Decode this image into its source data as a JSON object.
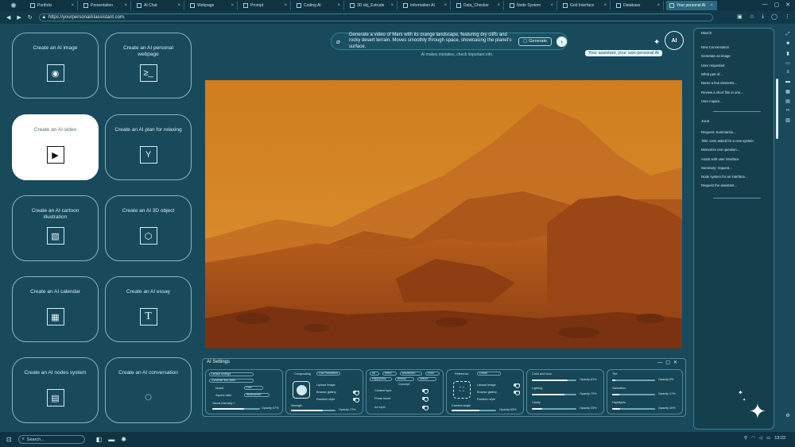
{
  "tabs": [
    {
      "label": "Portfolio"
    },
    {
      "label": "Presentation"
    },
    {
      "label": "AI Chat"
    },
    {
      "label": "Webpage"
    },
    {
      "label": "Prompt"
    },
    {
      "label": "Coding AI"
    },
    {
      "label": "3D obj_Extrude"
    },
    {
      "label": "Information AI"
    },
    {
      "label": "Data_Checker"
    },
    {
      "label": "Node System"
    },
    {
      "label": "Grid Interface"
    },
    {
      "label": "Database"
    },
    {
      "label": "Your personal AI"
    }
  ],
  "address": {
    "url": "https://yourpersonalAIassistant.com."
  },
  "cards": [
    {
      "label": "Create an AI image",
      "icon": "image-search-icon",
      "glyph": "◉"
    },
    {
      "label": "Create an AI personal webpage",
      "icon": "terminal-icon",
      "glyph": "≥_"
    },
    {
      "label": "Create an AI video",
      "icon": "play-icon",
      "glyph": "▶"
    },
    {
      "label": "Create an AI plan for relaxing",
      "icon": "cocktail-icon",
      "glyph": "Y"
    },
    {
      "label": "Create an AI cartoon illustration",
      "icon": "frame-icon",
      "glyph": "▧"
    },
    {
      "label": "Create an AI 3D object",
      "icon": "cube-icon",
      "glyph": "⬡"
    },
    {
      "label": "Create an AI calendar",
      "icon": "calendar-icon",
      "glyph": "▦"
    },
    {
      "label": "Create an AI essay",
      "icon": "text-icon",
      "glyph": "T"
    },
    {
      "label": "Create an AI nodes system",
      "icon": "nodes-icon",
      "glyph": "▤"
    },
    {
      "label": "Create an AI conversation",
      "icon": "loading-icon",
      "glyph": "◌"
    }
  ],
  "prompt": {
    "text": "Generate a video of Mars with its orange landscape, featuring dry cliffs and rocky desert terrain. Moves smoothly through space, showcasing the planet's surface.",
    "generate_label": "Generate",
    "disclaimer": "AI makes mistakes, check important info."
  },
  "assistant": {
    "logo_text": "AI",
    "tooltip": "Your assistant, your own personal AI"
  },
  "settings": {
    "title": "AI Settings",
    "g1": {
      "p1": "Default settings",
      "p2": "Generate this video",
      "model_label": "Model",
      "model_value": "Low",
      "ratio_label": "Aspect ratio",
      "ratio_value": "Widescreen",
      "intensity_label": "Visual Intensity +",
      "opacity": "Opacity 67%"
    },
    "g2": {
      "title": "Compositing",
      "res": "Low Resolution",
      "upload": "Upload Image",
      "browse": "Browse gallery",
      "random": "Random style",
      "strength": "Strength",
      "opacity": "Opacity 72%"
    },
    "g3": {
      "tags": [
        "All",
        "Retro",
        "Movement",
        "Punk",
        "Happyness",
        "Beauty",
        "Nature"
      ],
      "concept": "Concept",
      "content": "Content type",
      "photo": "Photo Insert",
      "art": "Art style"
    },
    "g4": {
      "title": "Reference",
      "res": "Linear",
      "upload": "Upload Image",
      "browse": "Browse gallery",
      "random": "Random style",
      "camera": "Camera angle",
      "opacity": "Opacity 63%"
    },
    "g5": {
      "color": "Color and tone",
      "color_op": "Opacity 81%",
      "lighting": "Lighting",
      "lighting_op": "Opacity 73%",
      "clarity": "Clarity",
      "clarity_op": "Opacity 23%"
    },
    "g6": {
      "tint": "Tint",
      "tint_op": "Opacity 8%",
      "saturation": "Saturation",
      "saturation_op": "Opacity 17%",
      "highlights": "Highlights",
      "highlights_op": "Opacity 19%"
    }
  },
  "sidebar": {
    "section1": "March",
    "items1": [
      "New Conversation",
      "Generate an image",
      "User requested",
      "What part of...",
      "Name a few elements...",
      "Review a short film in one...",
      "User inquire..."
    ],
    "section2": "June",
    "items2": [
      "Request: Summarize...",
      "Title: User asked for a new system",
      "Memorize one question...",
      "Assist with user interface",
      "Summary: request...",
      "Node system for an interface...",
      "Request the assistant..."
    ]
  },
  "taskbar": {
    "search_placeholder": "Search...",
    "time": "13:22"
  }
}
